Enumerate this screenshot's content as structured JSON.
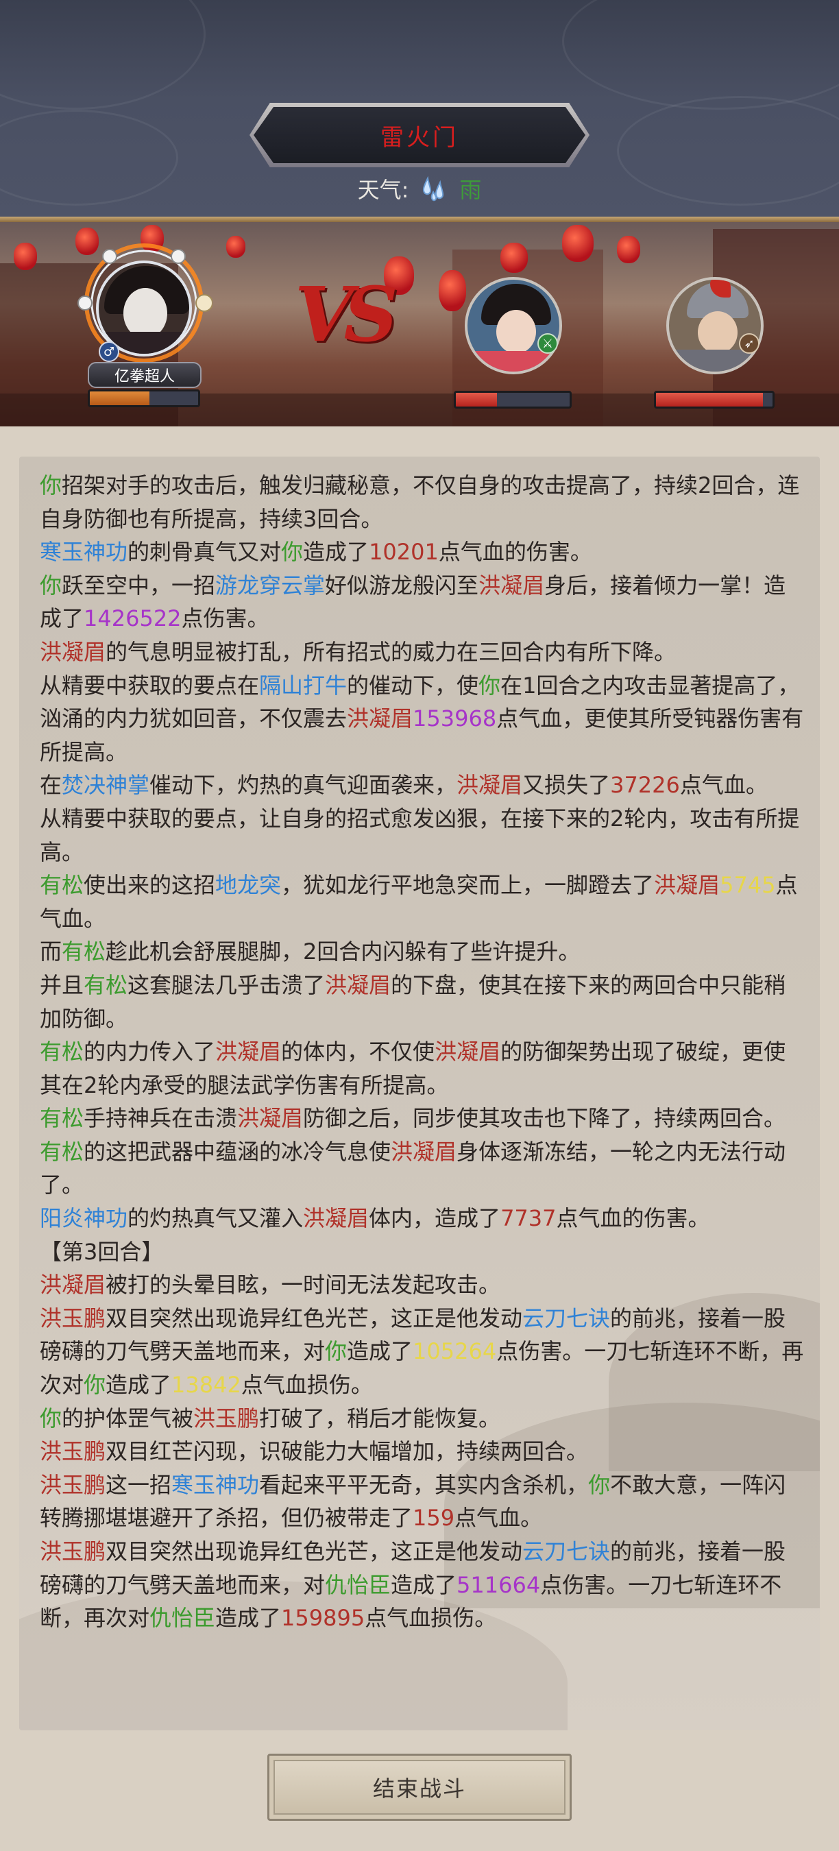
{
  "header": {
    "title": "雷火门",
    "weather_label": "天气:",
    "weather_icon": "rain-drops-icon",
    "weather_value": "雨"
  },
  "battle": {
    "vs_text": "VS",
    "player": {
      "name": "亿拳超人",
      "gender_icon": "male-icon",
      "hp_fraction": 0.55
    },
    "enemies": [
      {
        "role": "female-warrior",
        "badge_icon": "sword-badge-icon",
        "hp_fraction": 0.36
      },
      {
        "role": "armored-general",
        "badge_icon": "spear-badge-icon",
        "hp_fraction": 0.92
      }
    ]
  },
  "log": [
    [
      [
        "g",
        "你"
      ],
      [
        "d",
        "招架对手的攻击后，触发归藏秘意，不仅自身的攻击提高了，持续2回合，连自身防御也有所提高，持续3回合。"
      ]
    ],
    [
      [
        "b",
        "寒玉神功"
      ],
      [
        "d",
        "的刺骨真气又对"
      ],
      [
        "g",
        "你"
      ],
      [
        "d",
        "造成了"
      ],
      [
        "r",
        "10201"
      ],
      [
        "d",
        "点气血的伤害。"
      ]
    ],
    [
      [
        "g",
        "你"
      ],
      [
        "d",
        "跃至空中，一招"
      ],
      [
        "b",
        "游龙穿云掌"
      ],
      [
        "d",
        "好似游龙般闪至"
      ],
      [
        "r",
        "洪凝眉"
      ],
      [
        "d",
        "身后，接着倾力一掌！造成了"
      ],
      [
        "p",
        "1426522"
      ],
      [
        "d",
        "点伤害。"
      ]
    ],
    [
      [
        "r",
        "洪凝眉"
      ],
      [
        "d",
        "的气息明显被打乱，所有招式的威力在三回合内有所下降。"
      ]
    ],
    [
      [
        "d",
        "从精要中获取的要点在"
      ],
      [
        "b",
        "隔山打牛"
      ],
      [
        "d",
        "的催动下，使"
      ],
      [
        "g",
        "你"
      ],
      [
        "d",
        "在1回合之内攻击显著提高了，汹涌的内力犹如回音，不仅震去"
      ],
      [
        "r",
        "洪凝眉"
      ],
      [
        "p",
        "153968"
      ],
      [
        "d",
        "点气血，更使其所受钝器伤害有所提高。"
      ]
    ],
    [
      [
        "d",
        "在"
      ],
      [
        "b",
        "焚决神掌"
      ],
      [
        "d",
        "催动下，灼热的真气迎面袭来，"
      ],
      [
        "r",
        "洪凝眉"
      ],
      [
        "d",
        "又损失了"
      ],
      [
        "r",
        "37226"
      ],
      [
        "d",
        "点气血。"
      ]
    ],
    [
      [
        "d",
        "从精要中获取的要点，让自身的招式愈发凶狠，在接下来的2轮内，攻击有所提高。"
      ]
    ],
    [
      [
        "g",
        "有松"
      ],
      [
        "d",
        "使出来的这招"
      ],
      [
        "b",
        "地龙突"
      ],
      [
        "d",
        "，犹如龙行平地急突而上，一脚蹬去了"
      ],
      [
        "r",
        "洪凝眉"
      ],
      [
        "y",
        "5745"
      ],
      [
        "d",
        "点气血。"
      ]
    ],
    [
      [
        "d",
        "而"
      ],
      [
        "g",
        "有松"
      ],
      [
        "d",
        "趁此机会舒展腿脚，2回合内闪躲有了些许提升。"
      ]
    ],
    [
      [
        "d",
        "并且"
      ],
      [
        "g",
        "有松"
      ],
      [
        "d",
        "这套腿法几乎击溃了"
      ],
      [
        "r",
        "洪凝眉"
      ],
      [
        "d",
        "的下盘，使其在接下来的两回合中只能稍加防御。"
      ]
    ],
    [
      [
        "g",
        "有松"
      ],
      [
        "d",
        "的内力传入了"
      ],
      [
        "r",
        "洪凝眉"
      ],
      [
        "d",
        "的体内，不仅使"
      ],
      [
        "r",
        "洪凝眉"
      ],
      [
        "d",
        "的防御架势出现了破绽，更使其在2轮内承受的腿法武学伤害有所提高。"
      ]
    ],
    [
      [
        "g",
        "有松"
      ],
      [
        "d",
        "手持神兵在击溃"
      ],
      [
        "r",
        "洪凝眉"
      ],
      [
        "d",
        "防御之后，同步使其攻击也下降了，持续两回合。"
      ]
    ],
    [
      [
        "g",
        "有松"
      ],
      [
        "d",
        "的这把武器中蕴涵的冰冷气息使"
      ],
      [
        "r",
        "洪凝眉"
      ],
      [
        "d",
        "身体逐渐冻结，一轮之内无法行动了。"
      ]
    ],
    [
      [
        "b",
        "阳炎神功"
      ],
      [
        "d",
        "的灼热真气又灌入"
      ],
      [
        "r",
        "洪凝眉"
      ],
      [
        "d",
        "体内，造成了"
      ],
      [
        "r",
        "7737"
      ],
      [
        "d",
        "点气血的伤害。"
      ]
    ],
    [
      [
        "d",
        "【第3回合】"
      ]
    ],
    [
      [
        "r",
        "洪凝眉"
      ],
      [
        "d",
        "被打的头晕目眩，一时间无法发起攻击。"
      ]
    ],
    [
      [
        "r",
        "洪玉鹏"
      ],
      [
        "d",
        "双目突然出现诡异红色光芒，这正是他发动"
      ],
      [
        "b",
        "云刀七诀"
      ],
      [
        "d",
        "的前兆，接着一股磅礴的刀气劈天盖地而来，对"
      ],
      [
        "g",
        "你"
      ],
      [
        "d",
        "造成了"
      ],
      [
        "y",
        "105264"
      ],
      [
        "d",
        "点伤害。一刀七斩连环不断，再次对"
      ],
      [
        "g",
        "你"
      ],
      [
        "d",
        "造成了"
      ],
      [
        "y",
        "13842"
      ],
      [
        "d",
        "点气血损伤。"
      ]
    ],
    [
      [
        "g",
        "你"
      ],
      [
        "d",
        "的护体罡气被"
      ],
      [
        "r",
        "洪玉鹏"
      ],
      [
        "d",
        "打破了，稍后才能恢复。"
      ]
    ],
    [
      [
        "r",
        "洪玉鹏"
      ],
      [
        "d",
        "双目红芒闪现，识破能力大幅增加，持续两回合。"
      ]
    ],
    [
      [
        "r",
        "洪玉鹏"
      ],
      [
        "d",
        "这一招"
      ],
      [
        "b",
        "寒玉神功"
      ],
      [
        "d",
        "看起来平平无奇，其实内含杀机，"
      ],
      [
        "g",
        "你"
      ],
      [
        "d",
        "不敢大意，一阵闪转腾挪堪堪避开了杀招，但仍被带走了"
      ],
      [
        "r",
        "159"
      ],
      [
        "d",
        "点气血。"
      ]
    ],
    [
      [
        "r",
        "洪玉鹏"
      ],
      [
        "d",
        "双目突然出现诡异红色光芒，这正是他发动"
      ],
      [
        "b",
        "云刀七诀"
      ],
      [
        "d",
        "的前兆，接着一股磅礴的刀气劈天盖地而来，对"
      ],
      [
        "g",
        "仇怡臣"
      ],
      [
        "d",
        "造成了"
      ],
      [
        "p",
        "511664"
      ],
      [
        "d",
        "点伤害。一刀七斩连环不断，再次对"
      ],
      [
        "g",
        "仇怡臣"
      ],
      [
        "d",
        "造成了"
      ],
      [
        "r",
        "159895"
      ],
      [
        "d",
        "点气血损伤。"
      ]
    ]
  ],
  "colors": {
    "green": "#3c9b2e",
    "blue": "#2f82d6",
    "red": "#b0322a",
    "purple": "#a634c9",
    "yellow": "#e7d64a",
    "title_red": "#d81e1e"
  },
  "footer": {
    "end_button_label": "结束战斗"
  }
}
